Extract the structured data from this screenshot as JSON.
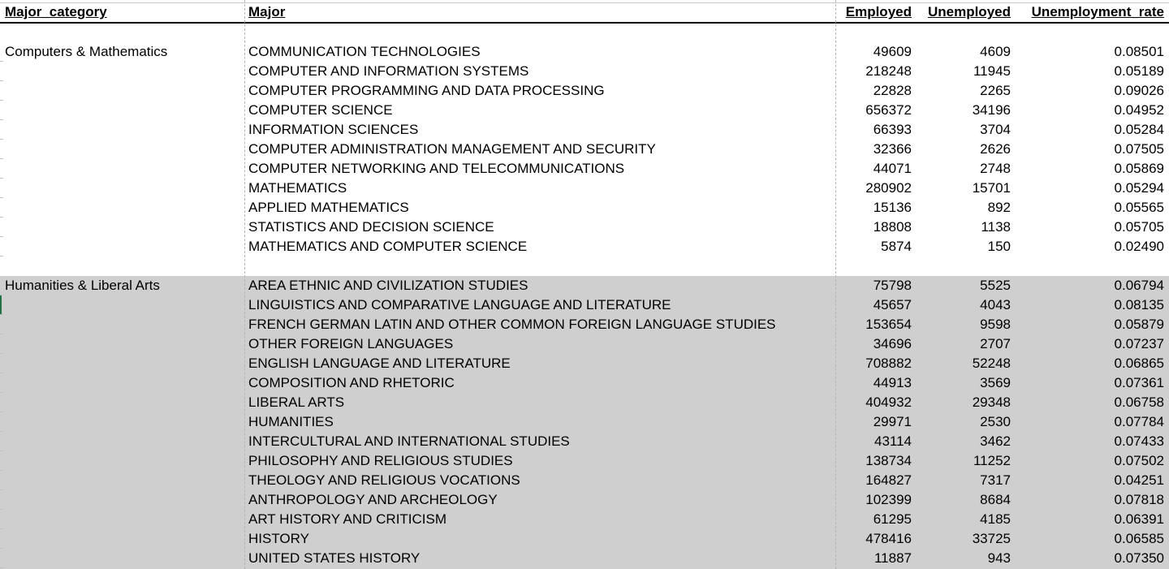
{
  "headers": {
    "category": "Major_category",
    "major": "Major",
    "employed": "Employed",
    "unemployed": "Unemployed",
    "rate": "Unemployment_rate"
  },
  "groups": [
    {
      "category": "Computers & Mathematics",
      "shaded": false,
      "rows": [
        {
          "major": "COMMUNICATION TECHNOLOGIES",
          "employed": "49609",
          "unemployed": "4609",
          "rate": "0.08501"
        },
        {
          "major": "COMPUTER AND INFORMATION SYSTEMS",
          "employed": "218248",
          "unemployed": "11945",
          "rate": "0.05189"
        },
        {
          "major": "COMPUTER PROGRAMMING AND DATA PROCESSING",
          "employed": "22828",
          "unemployed": "2265",
          "rate": "0.09026"
        },
        {
          "major": "COMPUTER SCIENCE",
          "employed": "656372",
          "unemployed": "34196",
          "rate": "0.04952"
        },
        {
          "major": "INFORMATION SCIENCES",
          "employed": "66393",
          "unemployed": "3704",
          "rate": "0.05284"
        },
        {
          "major": "COMPUTER ADMINISTRATION MANAGEMENT AND SECURITY",
          "employed": "32366",
          "unemployed": "2626",
          "rate": "0.07505"
        },
        {
          "major": "COMPUTER NETWORKING AND TELECOMMUNICATIONS",
          "employed": "44071",
          "unemployed": "2748",
          "rate": "0.05869"
        },
        {
          "major": "MATHEMATICS",
          "employed": "280902",
          "unemployed": "15701",
          "rate": "0.05294"
        },
        {
          "major": "APPLIED MATHEMATICS",
          "employed": "15136",
          "unemployed": "892",
          "rate": "0.05565"
        },
        {
          "major": "STATISTICS AND DECISION SCIENCE",
          "employed": "18808",
          "unemployed": "1138",
          "rate": "0.05705"
        },
        {
          "major": "MATHEMATICS AND COMPUTER SCIENCE",
          "employed": "5874",
          "unemployed": "150",
          "rate": "0.02490"
        }
      ]
    },
    {
      "category": "Humanities & Liberal Arts",
      "shaded": true,
      "rows": [
        {
          "major": "AREA ETHNIC AND CIVILIZATION STUDIES",
          "employed": "75798",
          "unemployed": "5525",
          "rate": "0.06794"
        },
        {
          "major": "LINGUISTICS AND COMPARATIVE LANGUAGE AND LITERATURE",
          "employed": "45657",
          "unemployed": "4043",
          "rate": "0.08135"
        },
        {
          "major": "FRENCH GERMAN LATIN AND OTHER COMMON FOREIGN LANGUAGE STUDIES",
          "employed": "153654",
          "unemployed": "9598",
          "rate": "0.05879"
        },
        {
          "major": "OTHER FOREIGN LANGUAGES",
          "employed": "34696",
          "unemployed": "2707",
          "rate": "0.07237"
        },
        {
          "major": "ENGLISH LANGUAGE AND LITERATURE",
          "employed": "708882",
          "unemployed": "52248",
          "rate": "0.06865"
        },
        {
          "major": "COMPOSITION AND RHETORIC",
          "employed": "44913",
          "unemployed": "3569",
          "rate": "0.07361"
        },
        {
          "major": "LIBERAL ARTS",
          "employed": "404932",
          "unemployed": "29348",
          "rate": "0.06758"
        },
        {
          "major": "HUMANITIES",
          "employed": "29971",
          "unemployed": "2530",
          "rate": "0.07784"
        },
        {
          "major": "INTERCULTURAL AND INTERNATIONAL STUDIES",
          "employed": "43114",
          "unemployed": "3462",
          "rate": "0.07433"
        },
        {
          "major": "PHILOSOPHY AND RELIGIOUS STUDIES",
          "employed": "138734",
          "unemployed": "11252",
          "rate": "0.07502"
        },
        {
          "major": "THEOLOGY AND RELIGIOUS VOCATIONS",
          "employed": "164827",
          "unemployed": "7317",
          "rate": "0.04251"
        },
        {
          "major": "ANTHROPOLOGY AND ARCHEOLOGY",
          "employed": "102399",
          "unemployed": "8684",
          "rate": "0.07818"
        },
        {
          "major": "ART HISTORY AND CRITICISM",
          "employed": "61295",
          "unemployed": "4185",
          "rate": "0.06391"
        },
        {
          "major": "HISTORY",
          "employed": "478416",
          "unemployed": "33725",
          "rate": "0.06585"
        },
        {
          "major": "UNITED STATES HISTORY",
          "employed": "11887",
          "unemployed": "943",
          "rate": "0.07350"
        }
      ]
    }
  ]
}
